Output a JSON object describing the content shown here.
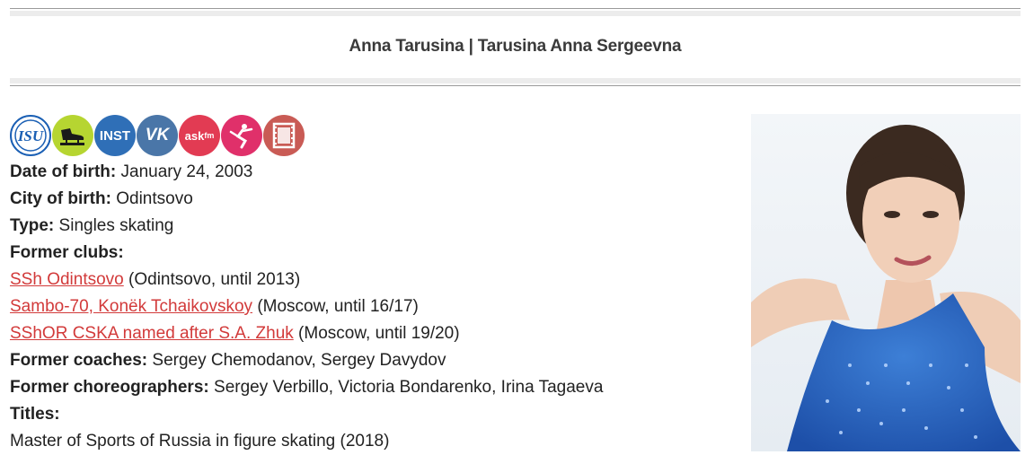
{
  "page": {
    "title": "Anna Tarusina | Tarusina Anna Sergeevna"
  },
  "social_icons": [
    {
      "name": "isu-icon",
      "label": "ISU",
      "bg": "#ffffff",
      "fg": "#1a5fb4"
    },
    {
      "name": "skate-icon",
      "label": "",
      "bg": "#b6d531",
      "fg": "#1a1a1a"
    },
    {
      "name": "instagram-icon",
      "label": "INST",
      "bg": "#2f6fb7",
      "fg": "#ffffff"
    },
    {
      "name": "vk-icon",
      "label": "VK",
      "bg": "#4a76a8",
      "fg": "#ffffff"
    },
    {
      "name": "askfm-icon",
      "label": "ask",
      "bg": "#e23b53",
      "fg": "#ffffff"
    },
    {
      "name": "skater-icon",
      "label": "",
      "bg": "#e0306a",
      "fg": "#ffffff"
    },
    {
      "name": "video-icon",
      "label": "",
      "bg": "#c95b55",
      "fg": "#ffffff"
    }
  ],
  "profile": {
    "dob_label": "Date of birth:",
    "dob_value": "January 24, 2003",
    "city_label": "City of birth:",
    "city_value": "Odintsovo",
    "type_label": "Type:",
    "type_value": "Singles skating",
    "clubs_label": "Former clubs:",
    "clubs": [
      {
        "link": "SSh Odintsovo",
        "note": "(Odintsovo, until 2013)"
      },
      {
        "link": "Sambo-70, Konëk Tchaikovskoy",
        "note": "(Moscow, until 16/17)"
      },
      {
        "link": "SShOR CSKA named after S.A. Zhuk",
        "note": "(Moscow, until 19/20)"
      }
    ],
    "coaches_label": "Former coaches:",
    "coaches_value": "Sergey Chemodanov, Sergey Davydov",
    "choreo_label": "Former choreographers:",
    "choreo_value": "Sergey Verbillo, Victoria Bondarenko, Irina Tagaeva",
    "titles_label": "Titles:",
    "titles_value": "Master of Sports of Russia in figure skating (2018)"
  },
  "colors": {
    "link": "#d23a3a",
    "divider": "#9a9a9a",
    "band": "#ececec"
  }
}
